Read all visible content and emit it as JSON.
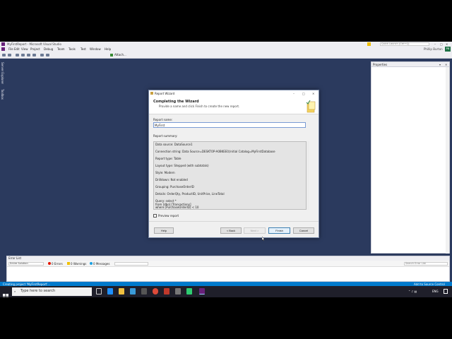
{
  "colors": {
    "vs_bg": "#2b3a5e",
    "status_bar": "#007acc",
    "taskbar": "#1f1f2a"
  },
  "vs": {
    "title": "MyFirstReport - Microsoft Visual Studio",
    "quick_launch": "Quick Launch (Ctrl+Q)",
    "user": "Phillip Burton",
    "avatar_initials": "PB",
    "menu": [
      "File",
      "Edit",
      "View",
      "Project",
      "Debug",
      "Team",
      "Tools",
      "Test",
      "Window",
      "Help"
    ],
    "attach_label": "Attach...",
    "side_tabs": [
      "Server Explorer",
      "Toolbox"
    ],
    "properties_title": "Properties",
    "error_list": {
      "title": "Error List",
      "scope": "Entire Solution",
      "errors": "0 Errors",
      "warnings": "0 Warnings",
      "messages": "0 Messages",
      "search_placeholder": "Search Error List"
    },
    "status": {
      "left": "Creating project 'MyFirstReport'...",
      "right": "Add to Source Control"
    }
  },
  "dialog": {
    "title": "Report Wizard",
    "heading": "Completing the Wizard",
    "subheading": "Provide a name and click Finish to create the new report.",
    "report_name_label": "Report name:",
    "report_name_value": "MyFirst",
    "summary_label": "Report summary:",
    "summary_lines": [
      "Data source: DataSource1",
      "",
      "Connection string: Data Source=DESKTOP-A0BKEE0;Initial Catalog=MyFirstDatabase",
      "",
      "Report type: Table",
      "",
      "Layout type: Stepped (with subtotals)",
      "",
      "Style: Modern",
      "",
      "Drilldown: Not enabled",
      "",
      "Grouping: PurchaseOrderID",
      "",
      "Details: OrderQty, ProductID, UnitPrice, LineTotal",
      "",
      "Query: select *",
      "from [dbo].[Transactions]",
      "where [PurchaseOrderID] < 10"
    ],
    "preview_label": "Preview report",
    "buttons": {
      "help": "Help",
      "back": "< Back",
      "next": "Next >",
      "finish": "Finish",
      "cancel": "Cancel"
    }
  },
  "taskbar": {
    "search_placeholder": "Type here to search",
    "tray_lang": "ENG",
    "time": "",
    "date": ""
  }
}
